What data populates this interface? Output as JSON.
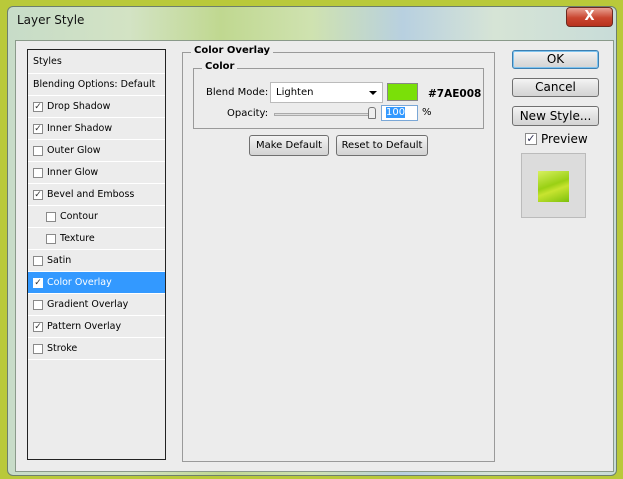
{
  "window": {
    "title": "Layer Style",
    "close": "X"
  },
  "styles_list": {
    "header": "Styles",
    "items": [
      {
        "label": "Blending Options: Default",
        "checkbox": false
      },
      {
        "label": "Drop Shadow",
        "checkbox": true,
        "checked": true
      },
      {
        "label": "Inner Shadow",
        "checkbox": true,
        "checked": true
      },
      {
        "label": "Outer Glow",
        "checkbox": true,
        "checked": false
      },
      {
        "label": "Inner Glow",
        "checkbox": true,
        "checked": false
      },
      {
        "label": "Bevel and Emboss",
        "checkbox": true,
        "checked": true
      },
      {
        "label": "Contour",
        "checkbox": true,
        "checked": false,
        "sub": true
      },
      {
        "label": "Texture",
        "checkbox": true,
        "checked": false,
        "sub": true
      },
      {
        "label": "Satin",
        "checkbox": true,
        "checked": false
      },
      {
        "label": "Color Overlay",
        "checkbox": true,
        "checked": true,
        "selected": true
      },
      {
        "label": "Gradient Overlay",
        "checkbox": true,
        "checked": false
      },
      {
        "label": "Pattern Overlay",
        "checkbox": true,
        "checked": true
      },
      {
        "label": "Stroke",
        "checkbox": true,
        "checked": false
      }
    ]
  },
  "panel": {
    "title": "Color Overlay",
    "color_group": "Color",
    "blend_mode_label": "Blend Mode:",
    "blend_mode": "Lighten",
    "color_hex": "#7AE008",
    "color": "#7ae008",
    "opacity_label": "Opacity:",
    "opacity": "100",
    "opacity_unit": "%",
    "make_default": "Make Default",
    "reset_default": "Reset to Default"
  },
  "buttons": {
    "ok": "OK",
    "cancel": "Cancel",
    "new_style": "New Style..."
  },
  "preview": {
    "label": "Preview",
    "checked": true
  }
}
